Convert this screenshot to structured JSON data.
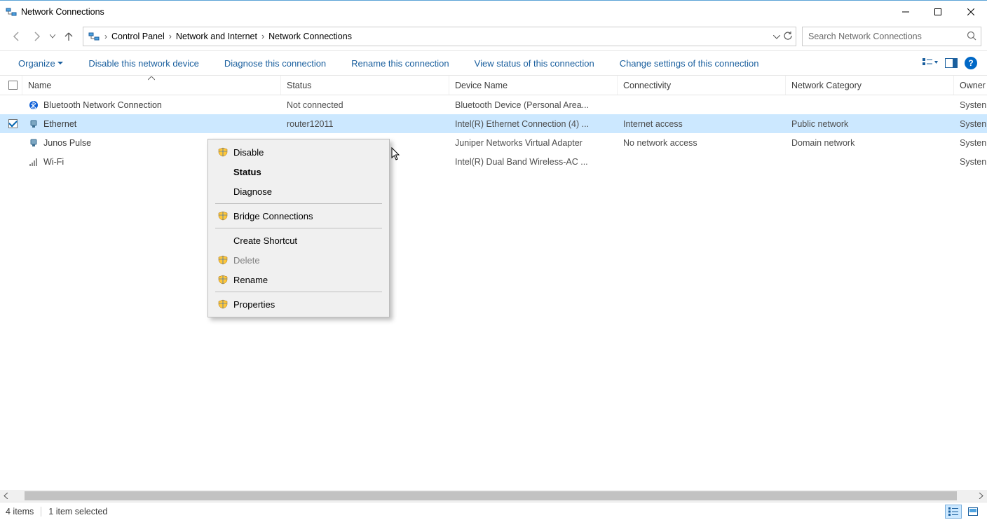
{
  "window": {
    "title": "Network Connections"
  },
  "breadcrumb": {
    "items": [
      "Control Panel",
      "Network and Internet",
      "Network Connections"
    ]
  },
  "search": {
    "placeholder": "Search Network Connections"
  },
  "toolbar": {
    "organize": "Organize",
    "disable": "Disable this network device",
    "diagnose": "Diagnose this connection",
    "rename": "Rename this connection",
    "view_status": "View status of this connection",
    "change_settings": "Change settings of this connection"
  },
  "columns": {
    "name": "Name",
    "status": "Status",
    "device": "Device Name",
    "connectivity": "Connectivity",
    "category": "Network Category",
    "owner": "Owner"
  },
  "rows": [
    {
      "checked": false,
      "icon": "bt",
      "name": "Bluetooth Network Connection",
      "status": "Not connected",
      "device": "Bluetooth Device (Personal Area...",
      "conn": "",
      "category": "",
      "owner": "Systen"
    },
    {
      "checked": true,
      "icon": "eth",
      "name": "Ethernet",
      "status": "router12011",
      "device": "Intel(R) Ethernet Connection (4) ...",
      "conn": "Internet access",
      "category": "Public network",
      "owner": "Systen",
      "selected": true
    },
    {
      "checked": false,
      "icon": "eth",
      "name": "Junos Pulse",
      "status": "",
      "device": "Juniper Networks Virtual Adapter",
      "conn": "No network access",
      "category": "Domain network",
      "owner": "Systen"
    },
    {
      "checked": false,
      "icon": "wifi",
      "name": "Wi-Fi",
      "status": "",
      "device": "Intel(R) Dual Band Wireless-AC ...",
      "conn": "",
      "category": "",
      "owner": "Systen"
    }
  ],
  "context_menu": {
    "disable": "Disable",
    "status": "Status",
    "diagnose": "Diagnose",
    "bridge": "Bridge Connections",
    "create_shortcut": "Create Shortcut",
    "delete": "Delete",
    "rename": "Rename",
    "properties": "Properties"
  },
  "statusbar": {
    "count": "4 items",
    "selected": "1 item selected"
  }
}
